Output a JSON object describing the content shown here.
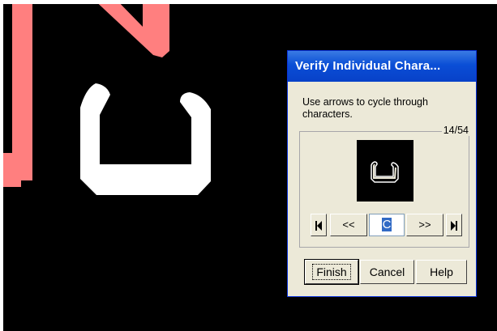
{
  "dialog": {
    "title": "Verify Individual Chara...",
    "instruction": "Use arrows to cycle through characters.",
    "counter": "14/54",
    "nav": {
      "prev_label": "<<",
      "next_label": ">>",
      "current_char": "C"
    },
    "buttons": {
      "finish": "Finish",
      "cancel": "Cancel",
      "help": "Help"
    }
  },
  "colors": {
    "background": "#000000",
    "stroke_red": "#ff7f7f",
    "stroke_white": "#ffffff",
    "title_bar": "#0a4ed6",
    "dialog_face": "#ece9d8",
    "selection": "#316ac5"
  },
  "icons": {
    "first": "skip-first-icon",
    "last": "skip-last-icon"
  }
}
